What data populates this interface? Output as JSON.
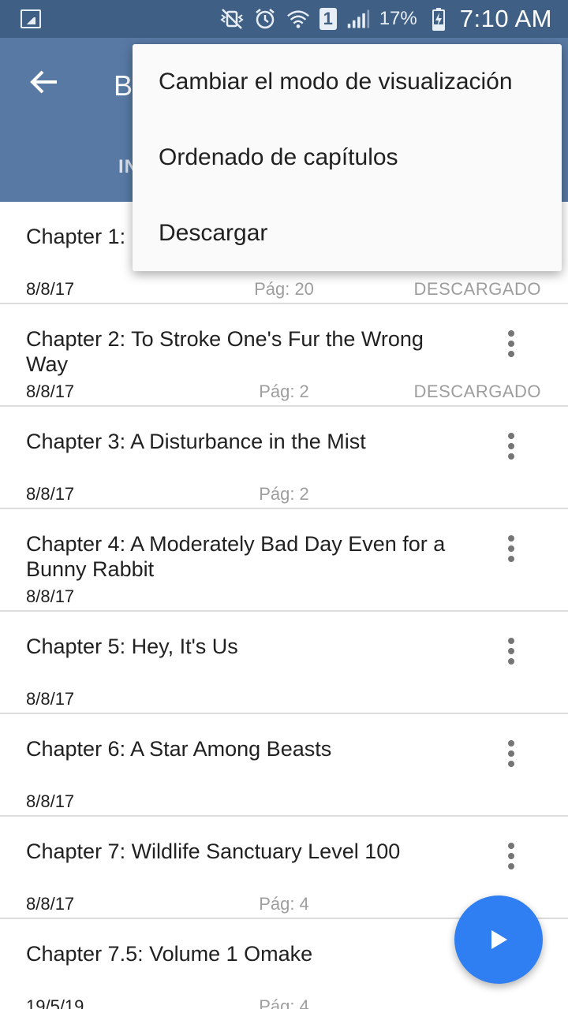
{
  "status_bar": {
    "battery_percent": "17%",
    "sim_slot": "1",
    "time": "7:10 AM"
  },
  "app_bar": {
    "title": "B",
    "tab_label": "IN"
  },
  "chapters": [
    {
      "title": "Chapter 1:                  Say Hi",
      "date": "8/8/17",
      "pages": "Pág: 20",
      "status": "DESCARGADO"
    },
    {
      "title": "Chapter 2: To Stroke One's Fur the Wrong Way",
      "date": "8/8/17",
      "pages": "Pág: 2",
      "status": "DESCARGADO"
    },
    {
      "title": "Chapter 3: A Disturbance in the Mist",
      "date": "8/8/17",
      "pages": "Pág: 2",
      "status": ""
    },
    {
      "title": "Chapter 4: A Moderately Bad Day Even for a Bunny Rabbit",
      "date": "8/8/17",
      "pages": "",
      "status": ""
    },
    {
      "title": "Chapter 5: Hey, It's Us",
      "date": "8/8/17",
      "pages": "",
      "status": ""
    },
    {
      "title": "Chapter 6: A Star Among Beasts",
      "date": "8/8/17",
      "pages": "",
      "status": ""
    },
    {
      "title": "Chapter 7: Wildlife Sanctuary Level 100",
      "date": "8/8/17",
      "pages": "Pág: 4",
      "status": ""
    },
    {
      "title": "Chapter 7.5: Volume 1 Omake",
      "date": "19/5/19",
      "pages": "Pág: 4",
      "status": ""
    }
  ],
  "menu": {
    "items": [
      {
        "label": "Cambiar el modo de visualización"
      },
      {
        "label": "Ordenado de capítulos"
      },
      {
        "label": "Descargar"
      }
    ]
  },
  "colors": {
    "status_bar": "#3f5f84",
    "app_bar": "#5879a4",
    "fab": "#2f7ef2"
  }
}
